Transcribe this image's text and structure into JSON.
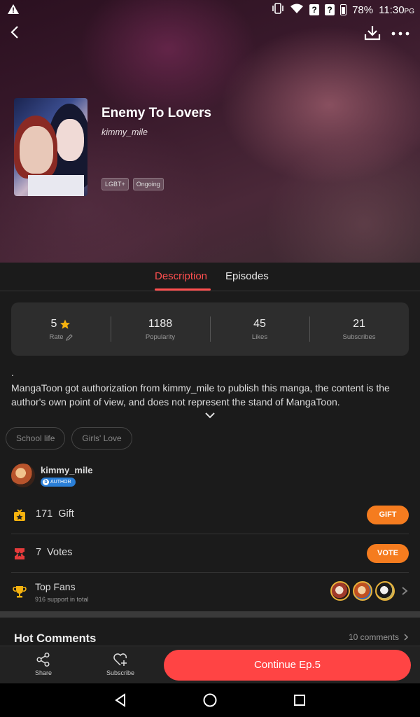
{
  "status_bar": {
    "battery": "78%",
    "time": "11:30",
    "time_suffix": "PG",
    "sim1": "?",
    "sim2": "?"
  },
  "manga": {
    "title": "Enemy To Lovers",
    "author": "kimmy_mile",
    "tags": [
      "LGBT+",
      "Ongoing"
    ]
  },
  "tabs": [
    {
      "label": "Description",
      "active": true
    },
    {
      "label": "Episodes",
      "active": false
    }
  ],
  "stats": [
    {
      "value": "5",
      "label": "Rate",
      "icon": "star-icon",
      "label_icon": "pencil-icon"
    },
    {
      "value": "1188",
      "label": "Popularity"
    },
    {
      "value": "45",
      "label": "Likes"
    },
    {
      "value": "21",
      "label": "Subscribes"
    }
  ],
  "description": {
    "first_line": ".",
    "text": "MangaToon got authorization from kimmy_mile to publish this manga, the content is the author's own point of view, and does not represent the stand of MangaToon."
  },
  "genres": [
    "School life",
    "Girls' Love"
  ],
  "author_card": {
    "name": "kimmy_mile",
    "badge": "AUTHOR"
  },
  "gift_row": {
    "count": "171",
    "label": "Gift",
    "button": "GIFT"
  },
  "votes_row": {
    "count": "7",
    "label": "Votes",
    "button": "VOTE"
  },
  "top_fans": {
    "title": "Top Fans",
    "subtitle": "916 support in total"
  },
  "hot_comments": {
    "title": "Hot Comments",
    "count_label": "10 comments"
  },
  "bottom_bar": {
    "share": "Share",
    "subscribe": "Subscribe",
    "continue": "Continue Ep.5"
  },
  "colors": {
    "accent": "#ff4f4f",
    "button_orange": "#f57c1f",
    "continue_red": "#ff4444",
    "background": "#1b1b1b"
  }
}
